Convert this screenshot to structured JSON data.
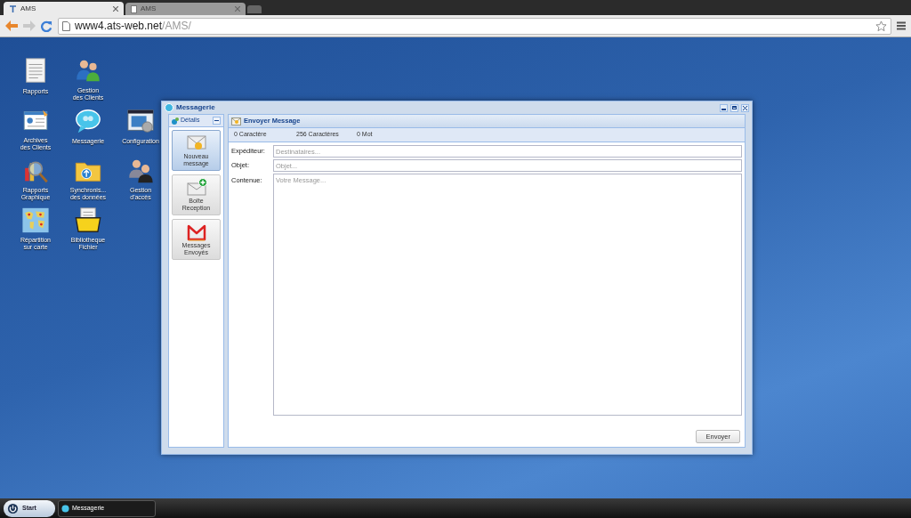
{
  "browser": {
    "tabs": [
      {
        "title": "AMS",
        "selected": true
      },
      {
        "title": "AMS",
        "selected": false
      }
    ],
    "address": {
      "host": "www4.ats-web.net",
      "path": "/AMS/"
    }
  },
  "desktop_icon_rows": [
    [
      {
        "label": "Rapports",
        "kind": "document"
      },
      {
        "label": "Gestion\ndes Clients",
        "kind": "users"
      }
    ],
    [
      {
        "label": "Archives\ndes Clients",
        "kind": "card"
      },
      {
        "label": "Messagerie",
        "kind": "bubble"
      },
      {
        "label": "Configuration",
        "kind": "settings"
      }
    ],
    [
      {
        "label": "Rapports\nGraphique",
        "kind": "chart"
      },
      {
        "label": "Synchronis...\ndes données",
        "kind": "folder"
      },
      {
        "label": "Gestion\nd'accès",
        "kind": "people"
      }
    ],
    [
      {
        "label": "Répartition\nsur carte",
        "kind": "map"
      },
      {
        "label": "Bibliotheque\nFichier",
        "kind": "openfolder"
      }
    ]
  ],
  "window": {
    "title": "Messagerie",
    "sidebar": {
      "title": "Détails",
      "items": [
        {
          "label": "Nouveau\nmessage",
          "kind": "new",
          "selected": true
        },
        {
          "label": "Boîte\nReception",
          "kind": "inbox",
          "selected": false
        },
        {
          "label": "Messages\nEnvoyés",
          "kind": "sent",
          "selected": false
        }
      ]
    },
    "panel": {
      "title": "Envoyer Message",
      "counters": [
        "0 Caractère",
        "256 Caractères",
        "0 Mot"
      ],
      "fields": [
        {
          "label": "Expéditeur:",
          "placeholder": "Destinataires...",
          "kind": "input"
        },
        {
          "label": "Objet:",
          "placeholder": "Objet...",
          "kind": "input"
        },
        {
          "label": "Contenue:",
          "placeholder": "Votre Message...",
          "kind": "textarea"
        }
      ],
      "button": "Envoyer"
    }
  },
  "taskbar": {
    "start": "Start",
    "tasks": [
      "Messagerie"
    ]
  }
}
